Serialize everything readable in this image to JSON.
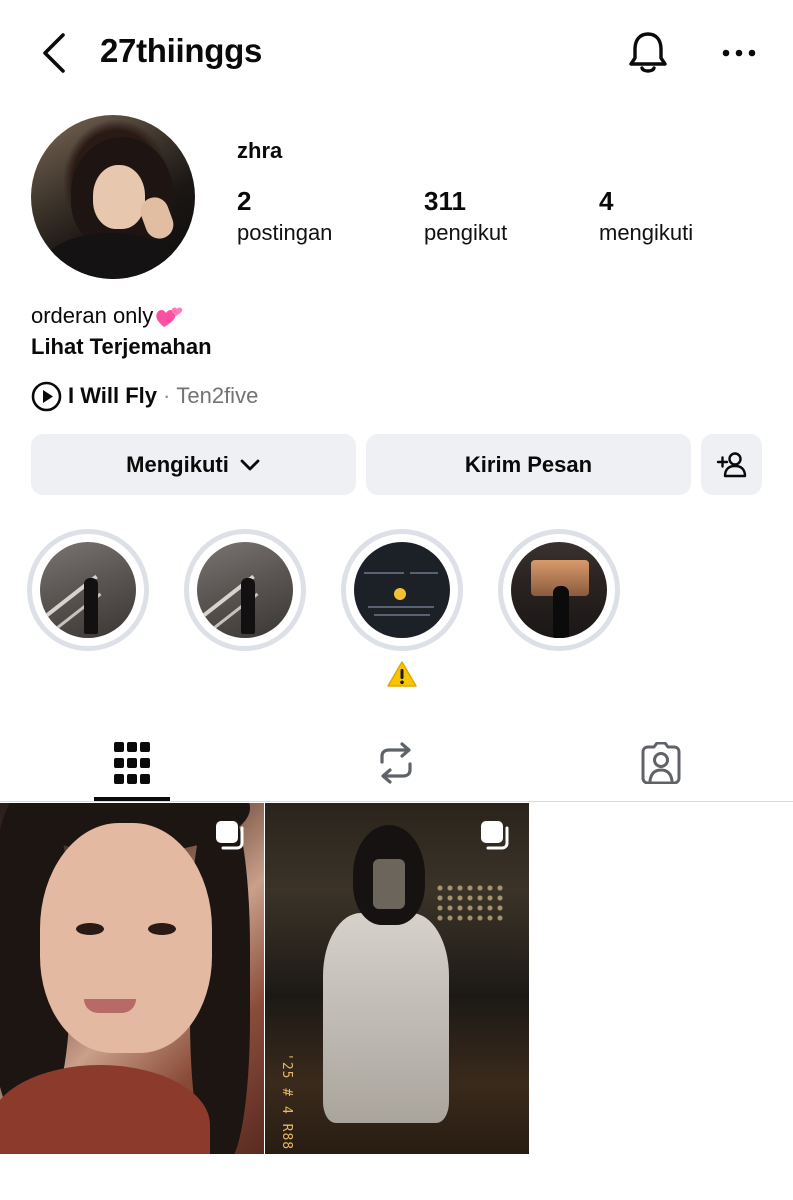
{
  "header": {
    "username": "27thiinggs",
    "back_icon": "chevron-left-icon",
    "notification_icon": "bell-icon",
    "more_icon": "more-horizontal-icon"
  },
  "profile": {
    "display_name": "zhra",
    "stats": {
      "posts": {
        "count": "2",
        "label": "postingan"
      },
      "followers": {
        "count": "311",
        "label": "pengikut"
      },
      "following": {
        "count": "4",
        "label": "mengikuti"
      }
    },
    "bio": "orderan only",
    "bio_emoji": "two-hearts-icon",
    "translate_label": "Lihat Terjemahan",
    "music": {
      "song": "I Will Fly",
      "separator": "·",
      "artist": "Ten2five"
    }
  },
  "actions": {
    "follow_label": "Mengikuti",
    "message_label": "Kirim Pesan",
    "add_user_icon": "add-person-icon"
  },
  "highlights": {
    "count": 4,
    "warning_icon": "warning-icon"
  },
  "tabs": [
    {
      "name": "posts-grid",
      "icon": "grid-icon",
      "active": true
    },
    {
      "name": "reposts",
      "icon": "repost-icon",
      "active": false
    },
    {
      "name": "tagged",
      "icon": "tagged-person-icon",
      "active": false
    }
  ],
  "posts": {
    "count": 2,
    "multi_icon": "multiple-photos-icon",
    "post2_stamp": "'25 # 4 R88"
  },
  "colors": {
    "button_bg": "#eef0f3",
    "highlight_ring": "#dde1e7",
    "secondary_text": "#737373",
    "accent_heart": "#ff4fa3",
    "warning": "#f7c600"
  }
}
